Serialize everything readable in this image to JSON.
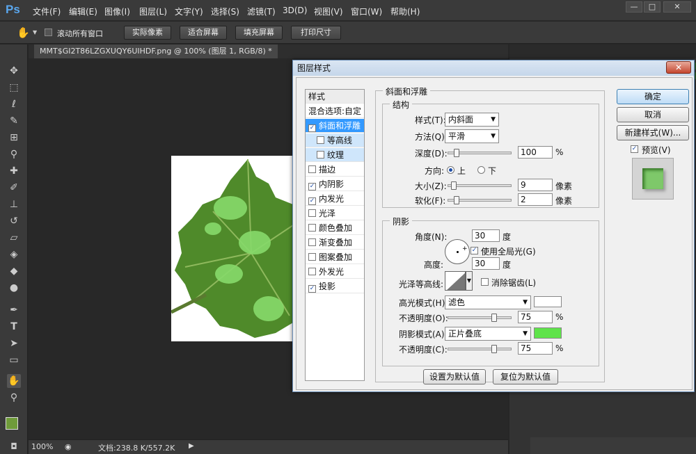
{
  "app": {
    "logo": "Ps"
  },
  "menu": [
    "文件(F)",
    "编辑(E)",
    "图像(I)",
    "图层(L)",
    "文字(Y)",
    "选择(S)",
    "滤镜(T)",
    "3D(D)",
    "视图(V)",
    "窗口(W)",
    "帮助(H)"
  ],
  "window_controls": {
    "minimize": "—",
    "maximize": "□",
    "close": "✕"
  },
  "options": {
    "scroll_all_label": "滚动所有窗口",
    "actual_pixels": "实际像素",
    "fit_screen": "适合屏幕",
    "fill_screen": "填充屏幕",
    "print_size": "打印尺寸"
  },
  "doc_tab": "MMT$GI2T86LZGXUQY6UIHDF.png @ 100% (图层 1, RGB/8) *",
  "status": {
    "zoom": "100%",
    "doc_info": "文档:238.8 K/557.2K"
  },
  "dialog": {
    "title": "图层样式",
    "close": "✕",
    "style_header": "样式",
    "blend_options": "混合选项:自定",
    "styles": [
      {
        "label": "斜面和浮雕",
        "checked": true
      },
      {
        "label": "等高线",
        "checked": false
      },
      {
        "label": "纹理",
        "checked": false
      },
      {
        "label": "描边",
        "checked": false
      },
      {
        "label": "内阴影",
        "checked": true
      },
      {
        "label": "内发光",
        "checked": true
      },
      {
        "label": "光泽",
        "checked": false
      },
      {
        "label": "颜色叠加",
        "checked": false
      },
      {
        "label": "渐变叠加",
        "checked": false
      },
      {
        "label": "图案叠加",
        "checked": false
      },
      {
        "label": "外发光",
        "checked": false
      },
      {
        "label": "投影",
        "checked": true
      }
    ],
    "section_title": "斜面和浮雕",
    "structure": {
      "title": "结构",
      "style_label": "样式(T):",
      "style_value": "内斜面",
      "technique_label": "方法(Q):",
      "technique_value": "平滑",
      "depth_label": "深度(D):",
      "depth_value": "100",
      "depth_unit": "%",
      "depth_fraction": 0.1,
      "direction_label": "方向:",
      "dir_up": "上",
      "dir_down": "下",
      "size_label": "大小(Z):",
      "size_value": "9",
      "size_unit": "像素",
      "size_fraction": 0.05,
      "soften_label": "软化(F):",
      "soften_value": "2",
      "soften_unit": "像素",
      "soften_fraction": 0.1
    },
    "shading": {
      "title": "阴影",
      "angle_label": "角度(N):",
      "angle_value": "30",
      "angle_unit": "度",
      "global_light": "使用全局光(G)",
      "altitude_label": "高度:",
      "altitude_value": "30",
      "altitude_unit": "度",
      "gloss_label": "光泽等高线:",
      "anti_alias": "消除锯齿(L)",
      "highlight_mode_label": "高光模式(H):",
      "highlight_mode": "滤色",
      "highlight_color": "#ffffff",
      "highlight_opacity_label": "不透明度(O):",
      "highlight_opacity": "75",
      "highlight_opacity_fraction": 0.75,
      "shadow_mode_label": "阴影模式(A):",
      "shadow_mode": "正片叠底",
      "shadow_color": "#5fe34a",
      "shadow_opacity_label": "不透明度(C):",
      "shadow_opacity": "75",
      "shadow_opacity_fraction": 0.75,
      "percent": "%"
    },
    "make_default": "设置为默认值",
    "reset_default": "复位为默认值",
    "ok": "确定",
    "cancel": "取消",
    "new_style": "新建样式(W)...",
    "preview": "预览(V)"
  }
}
